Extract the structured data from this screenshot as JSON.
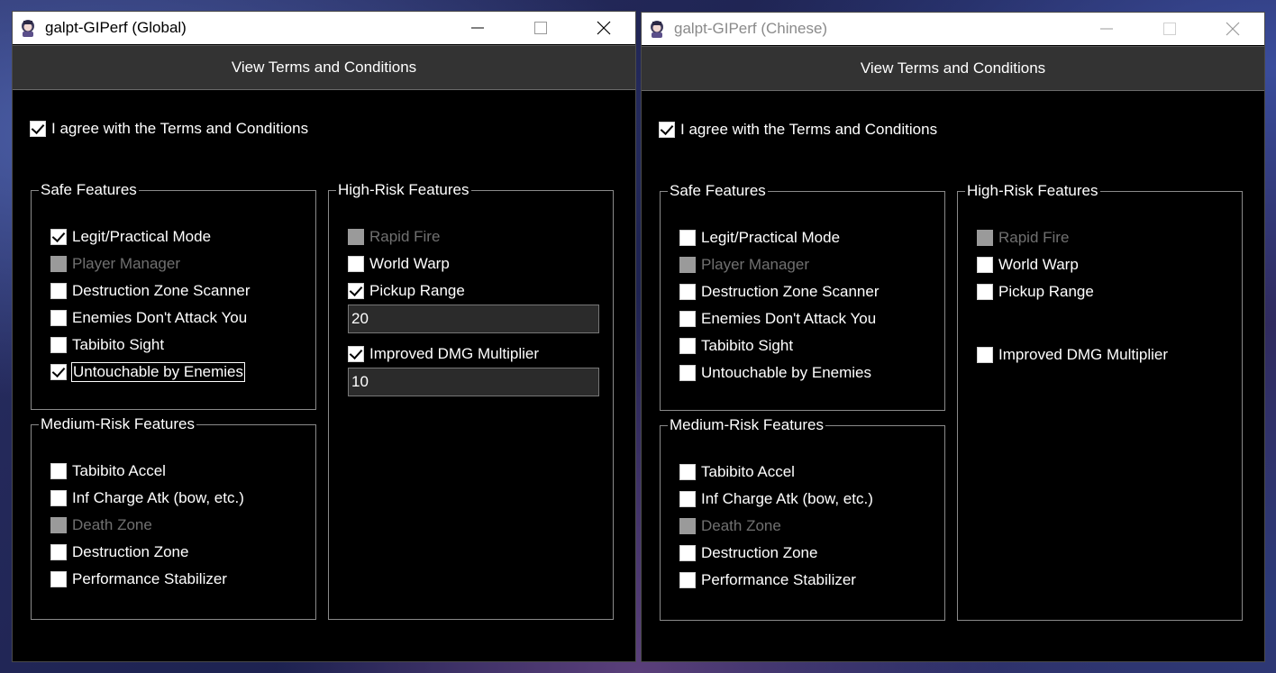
{
  "windows": [
    {
      "title": "galpt-GIPerf (Global)",
      "terms_button": "View Terms and Conditions",
      "agree_label": "I agree with the Terms and Conditions",
      "agree_checked": true,
      "safe": {
        "title": "Safe Features",
        "items": [
          {
            "label": "Legit/Practical Mode",
            "checked": true,
            "disabled": false
          },
          {
            "label": "Player Manager",
            "checked": false,
            "disabled": true
          },
          {
            "label": "Destruction Zone Scanner",
            "checked": false,
            "disabled": false
          },
          {
            "label": "Enemies Don't Attack You",
            "checked": false,
            "disabled": false
          },
          {
            "label": "Tabibito Sight",
            "checked": false,
            "disabled": false
          },
          {
            "label": "Untouchable by Enemies",
            "checked": true,
            "disabled": false
          }
        ]
      },
      "medium": {
        "title": "Medium-Risk Features",
        "items": [
          {
            "label": "Tabibito Accel",
            "checked": false,
            "disabled": false
          },
          {
            "label": "Inf Charge Atk (bow, etc.)",
            "checked": false,
            "disabled": false
          },
          {
            "label": "Death Zone",
            "checked": false,
            "disabled": true
          },
          {
            "label": "Destruction Zone",
            "checked": false,
            "disabled": false
          },
          {
            "label": "Performance Stabilizer",
            "checked": false,
            "disabled": false
          }
        ]
      },
      "high": {
        "title": "High-Risk Features",
        "rapid_fire": "Rapid Fire",
        "world_warp": "World Warp",
        "pickup_range": "Pickup Range",
        "pickup_value": "20",
        "dmg_multiplier": "Improved DMG Multiplier",
        "dmg_value": "10"
      }
    },
    {
      "title": "galpt-GIPerf (Chinese)",
      "terms_button": "View Terms and Conditions",
      "agree_label": "I agree with the Terms and Conditions",
      "agree_checked": true,
      "safe": {
        "title": "Safe Features",
        "items": [
          {
            "label": "Legit/Practical Mode",
            "checked": false,
            "disabled": false
          },
          {
            "label": "Player Manager",
            "checked": false,
            "disabled": true
          },
          {
            "label": "Destruction Zone Scanner",
            "checked": false,
            "disabled": false
          },
          {
            "label": "Enemies Don't Attack You",
            "checked": false,
            "disabled": false
          },
          {
            "label": "Tabibito Sight",
            "checked": false,
            "disabled": false
          },
          {
            "label": "Untouchable by Enemies",
            "checked": false,
            "disabled": false
          }
        ]
      },
      "medium": {
        "title": "Medium-Risk Features",
        "items": [
          {
            "label": "Tabibito Accel",
            "checked": false,
            "disabled": false
          },
          {
            "label": "Inf Charge Atk (bow, etc.)",
            "checked": false,
            "disabled": false
          },
          {
            "label": "Death Zone",
            "checked": false,
            "disabled": true
          },
          {
            "label": "Destruction Zone",
            "checked": false,
            "disabled": false
          },
          {
            "label": "Performance Stabilizer",
            "checked": false,
            "disabled": false
          }
        ]
      },
      "high": {
        "title": "High-Risk Features",
        "rapid_fire": "Rapid Fire",
        "world_warp": "World Warp",
        "pickup_range": "Pickup Range",
        "dmg_multiplier": "Improved DMG Multiplier"
      }
    }
  ]
}
